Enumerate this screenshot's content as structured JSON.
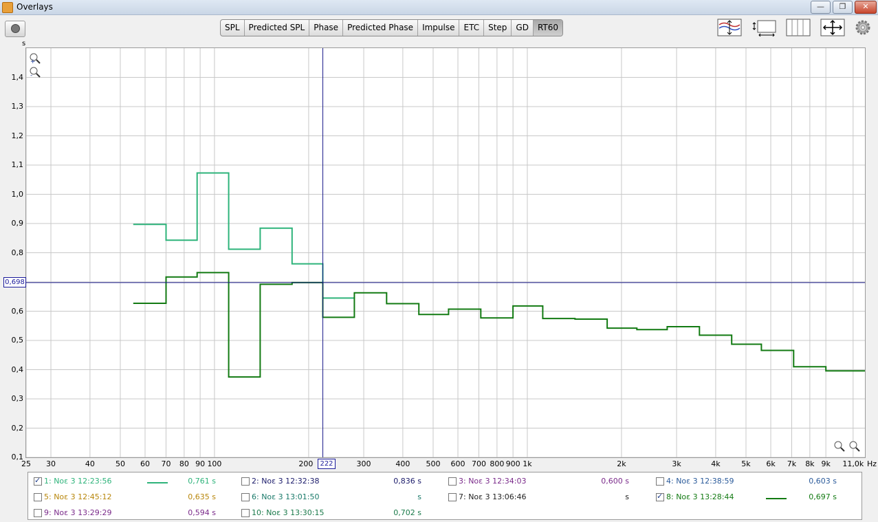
{
  "window": {
    "title": "Overlays",
    "min": "—",
    "max": "❐",
    "close": "✕"
  },
  "tabs": [
    {
      "label": "SPL",
      "active": false
    },
    {
      "label": "Predicted SPL",
      "active": false
    },
    {
      "label": "Phase",
      "active": false
    },
    {
      "label": "Predicted Phase",
      "active": false
    },
    {
      "label": "Impulse",
      "active": false
    },
    {
      "label": "ETC",
      "active": false
    },
    {
      "label": "Step",
      "active": false
    },
    {
      "label": "GD",
      "active": false
    },
    {
      "label": "RT60",
      "active": true
    }
  ],
  "toolbar_icons": [
    "overlay-adjust-icon",
    "limits-icon",
    "grid-icon",
    "pan-icon",
    "gear-icon"
  ],
  "chart_data": {
    "type": "line",
    "ylabel_unit": "s",
    "xlabel_unit": "Hz",
    "x_scale": "log",
    "xlim": [
      25,
      12000
    ],
    "ylim": [
      0.1,
      1.5
    ],
    "y_ticks": [
      "1,4",
      "1,3",
      "1,2",
      "1,1",
      "1,0",
      "0,9",
      "0,8",
      "0,7",
      "0,6",
      "0,5",
      "0,4",
      "0,3",
      "0,2",
      "0,1"
    ],
    "y_tick_values": [
      1.4,
      1.3,
      1.2,
      1.1,
      1.0,
      0.9,
      0.8,
      0.7,
      0.6,
      0.5,
      0.4,
      0.3,
      0.2,
      0.1
    ],
    "x_ticks": [
      {
        "v": 25,
        "t": "25"
      },
      {
        "v": 30,
        "t": "30"
      },
      {
        "v": 40,
        "t": "40"
      },
      {
        "v": 50,
        "t": "50"
      },
      {
        "v": 60,
        "t": "60"
      },
      {
        "v": 70,
        "t": "70"
      },
      {
        "v": 80,
        "t": "80"
      },
      {
        "v": 90,
        "t": "90"
      },
      {
        "v": 100,
        "t": "100"
      },
      {
        "v": 200,
        "t": "200"
      },
      {
        "v": 300,
        "t": "300"
      },
      {
        "v": 400,
        "t": "400"
      },
      {
        "v": 500,
        "t": "500"
      },
      {
        "v": 600,
        "t": "600"
      },
      {
        "v": 700,
        "t": "700"
      },
      {
        "v": 800,
        "t": "800"
      },
      {
        "v": 900,
        "t": "900"
      },
      {
        "v": 1000,
        "t": "1k"
      },
      {
        "v": 2000,
        "t": "2k"
      },
      {
        "v": 3000,
        "t": "3k"
      },
      {
        "v": 4000,
        "t": "4k"
      },
      {
        "v": 5000,
        "t": "5k"
      },
      {
        "v": 6000,
        "t": "6k"
      },
      {
        "v": 7000,
        "t": "7k"
      },
      {
        "v": 8000,
        "t": "8k"
      },
      {
        "v": 9000,
        "t": "9k"
      },
      {
        "v": 11000,
        "t": "11,0k"
      }
    ],
    "cursor": {
      "x": 222,
      "x_label": "222",
      "y": 0.698,
      "y_label": "0,698"
    },
    "series": [
      {
        "color": "#2db37a",
        "steps": [
          {
            "x0": 55,
            "x1": 70,
            "y": 0.897
          },
          {
            "x0": 70,
            "x1": 88,
            "y": 0.843
          },
          {
            "x0": 88,
            "x1": 111,
            "y": 1.073
          },
          {
            "x0": 111,
            "x1": 140,
            "y": 0.812
          },
          {
            "x0": 140,
            "x1": 177,
            "y": 0.884
          },
          {
            "x0": 177,
            "x1": 222,
            "y": 0.762
          },
          {
            "x0": 222,
            "x1": 280,
            "y": 0.645
          }
        ]
      },
      {
        "color": "#127a12",
        "steps": [
          {
            "x0": 55,
            "x1": 70,
            "y": 0.627
          },
          {
            "x0": 70,
            "x1": 88,
            "y": 0.717
          },
          {
            "x0": 88,
            "x1": 111,
            "y": 0.732
          },
          {
            "x0": 111,
            "x1": 140,
            "y": 0.375
          },
          {
            "x0": 140,
            "x1": 177,
            "y": 0.692
          },
          {
            "x0": 177,
            "x1": 222,
            "y": 0.698
          },
          {
            "x0": 222,
            "x1": 280,
            "y": 0.579
          },
          {
            "x0": 280,
            "x1": 355,
            "y": 0.663
          },
          {
            "x0": 355,
            "x1": 450,
            "y": 0.626
          },
          {
            "x0": 450,
            "x1": 560,
            "y": 0.589
          },
          {
            "x0": 560,
            "x1": 710,
            "y": 0.607
          },
          {
            "x0": 710,
            "x1": 900,
            "y": 0.577
          },
          {
            "x0": 900,
            "x1": 1120,
            "y": 0.618
          },
          {
            "x0": 1120,
            "x1": 1420,
            "y": 0.575
          },
          {
            "x0": 1420,
            "x1": 1800,
            "y": 0.573
          },
          {
            "x0": 1800,
            "x1": 2240,
            "y": 0.542
          },
          {
            "x0": 2240,
            "x1": 2800,
            "y": 0.537
          },
          {
            "x0": 2800,
            "x1": 3550,
            "y": 0.547
          },
          {
            "x0": 3550,
            "x1": 4500,
            "y": 0.518
          },
          {
            "x0": 4500,
            "x1": 5600,
            "y": 0.487
          },
          {
            "x0": 5600,
            "x1": 7100,
            "y": 0.466
          },
          {
            "x0": 7100,
            "x1": 9000,
            "y": 0.41
          },
          {
            "x0": 9000,
            "x1": 12000,
            "y": 0.396
          }
        ]
      }
    ]
  },
  "legend": [
    {
      "checked": true,
      "name": "1: Νοε 3 12:23:56",
      "value": "0,761 s",
      "color": "#2db37a",
      "show_line": true
    },
    {
      "checked": false,
      "name": "2: Νοε 3 12:32:38",
      "value": "0,836 s",
      "color": "#1a1a6a",
      "show_line": false
    },
    {
      "checked": false,
      "name": "3: Νοε 3 12:34:03",
      "value": "0,600 s",
      "color": "#7a2a8a",
      "show_line": false
    },
    {
      "checked": false,
      "name": "4: Νοε 3 12:38:59",
      "value": "0,603 s",
      "color": "#2a5a9a",
      "show_line": false
    },
    {
      "checked": false,
      "name": "5: Νοε 3 12:45:12",
      "value": "0,635 s",
      "color": "#b8860b",
      "show_line": false
    },
    {
      "checked": false,
      "name": "6: Νοε 3 13:01:50",
      "value": "s",
      "color": "#1a7a6a",
      "show_line": false
    },
    {
      "checked": false,
      "name": "7: Νοε 3 13:06:46",
      "value": "s",
      "color": "#222222",
      "show_line": false
    },
    {
      "checked": true,
      "name": "8: Νοε 3 13:28:44",
      "value": "0,697 s",
      "color": "#127a12",
      "show_line": true
    },
    {
      "checked": false,
      "name": "9: Νοε 3 13:29:29",
      "value": "0,594 s",
      "color": "#7a2a8a",
      "show_line": false
    },
    {
      "checked": false,
      "name": "10: Νοε 3 13:30:15",
      "value": "0,702 s",
      "color": "#1a7a4a",
      "show_line": false
    }
  ]
}
